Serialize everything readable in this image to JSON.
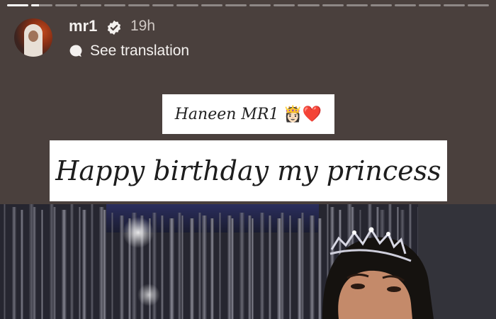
{
  "story": {
    "progress": [
      {
        "fill": 1.0
      },
      {
        "fill": 0.35
      },
      {
        "fill": 0
      },
      {
        "fill": 0
      },
      {
        "fill": 0
      },
      {
        "fill": 0
      },
      {
        "fill": 0
      },
      {
        "fill": 0
      },
      {
        "fill": 0
      },
      {
        "fill": 0
      },
      {
        "fill": 0
      },
      {
        "fill": 0
      },
      {
        "fill": 0
      },
      {
        "fill": 0
      },
      {
        "fill": 0
      },
      {
        "fill": 0
      },
      {
        "fill": 0
      },
      {
        "fill": 0
      },
      {
        "fill": 0
      },
      {
        "fill": 0
      }
    ]
  },
  "header": {
    "username": "mr1",
    "verified_icon": "verified-badge-icon",
    "time": "19h",
    "translation_icon": "speech-bubble-icon",
    "translation_label": "See translation"
  },
  "captions": {
    "name_line": "Haneen MR1",
    "name_emojis": "👸🏻❤️",
    "message": "Happy birthday my princess"
  },
  "colors": {
    "background": "#4a403d",
    "text": "#f4f1ef",
    "caption_bg": "#ffffff"
  }
}
